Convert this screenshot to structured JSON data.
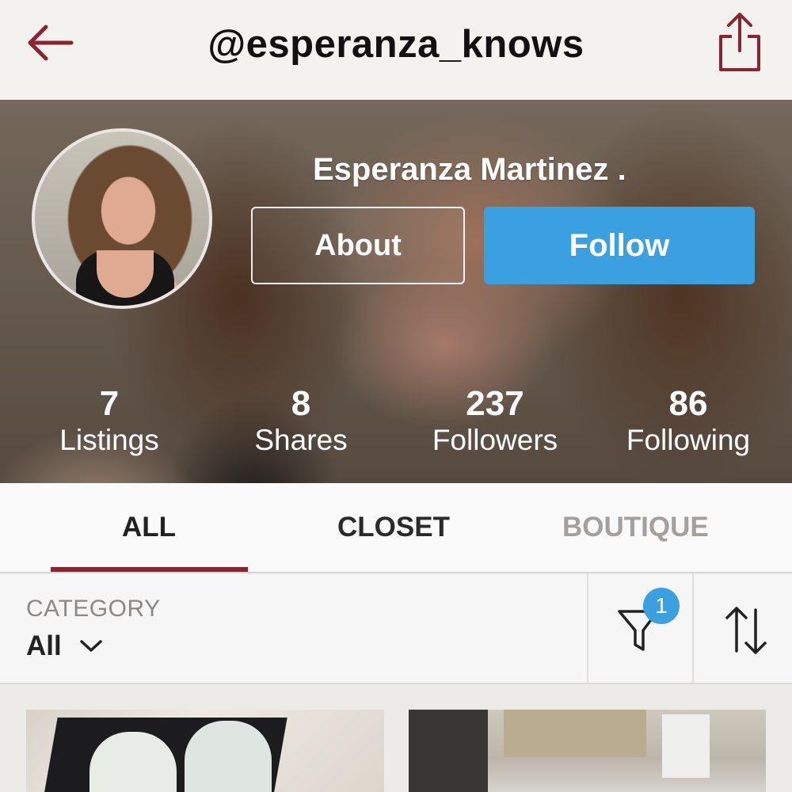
{
  "header": {
    "title": "@esperanza_knows",
    "back_icon": "arrow-left-icon",
    "share_icon": "share-icon",
    "accent": "#8b2431"
  },
  "profile": {
    "name": "Esperanza Martinez .",
    "about_label": "About",
    "follow_label": "Follow",
    "follow_color": "#3ba0df",
    "stats": [
      {
        "value": "7",
        "label": "Listings"
      },
      {
        "value": "8",
        "label": "Shares"
      },
      {
        "value": "237",
        "label": "Followers"
      },
      {
        "value": "86",
        "label": "Following"
      }
    ]
  },
  "tabs": [
    {
      "label": "ALL",
      "active": true
    },
    {
      "label": "CLOSET",
      "active": false
    },
    {
      "label": "BOUTIQUE",
      "active": false
    }
  ],
  "filter": {
    "category_label": "CATEGORY",
    "category_value": "All",
    "filter_badge": "1"
  }
}
